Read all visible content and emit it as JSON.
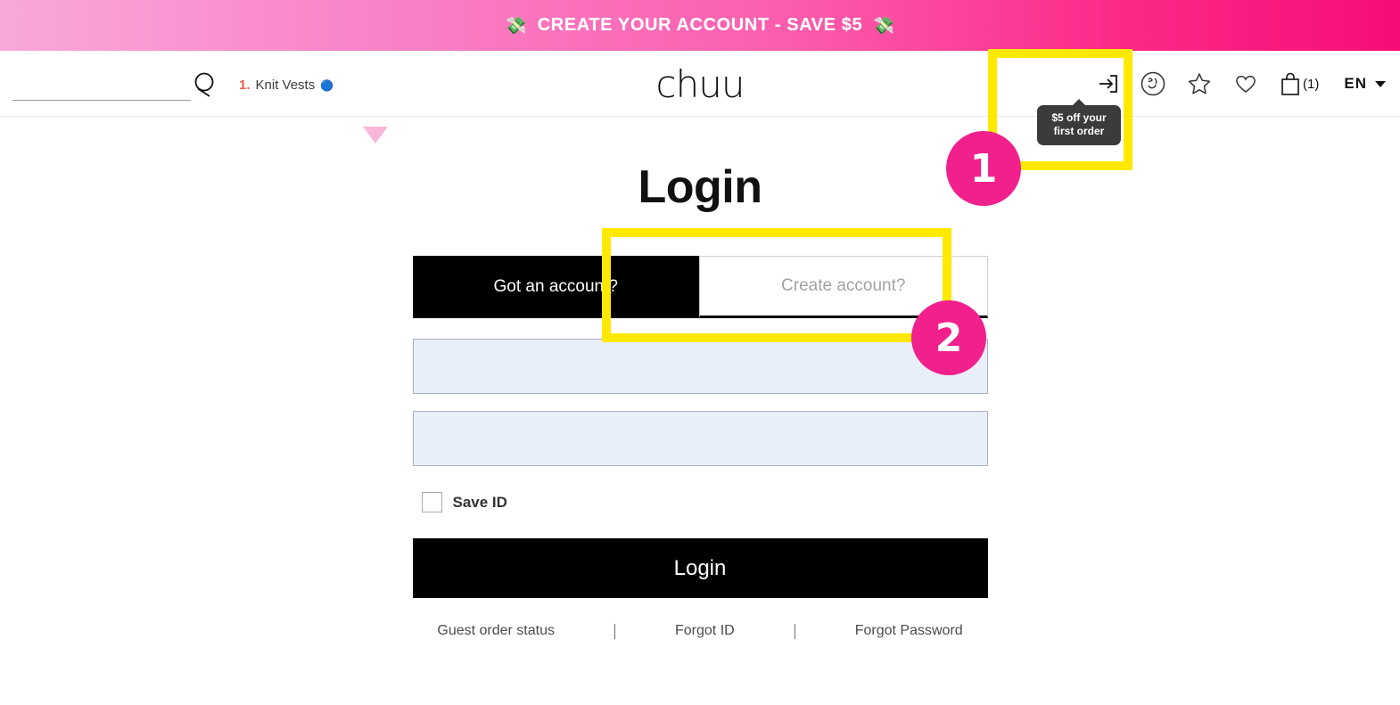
{
  "promo": {
    "text": "CREATE YOUR ACCOUNT - SAVE $5",
    "emoji_left": "💸",
    "emoji_right": "💸",
    "gradient_from": "#f9a9d8",
    "gradient_to": "#f70d74"
  },
  "header": {
    "search": {
      "value": "",
      "placeholder": ""
    },
    "search_icon": "search-icon",
    "hot_keyword": {
      "rank": "1.",
      "word": "Knit Vests",
      "emoji": "🔵"
    },
    "keyword_toggle_icon": "triangle-down-icon",
    "logo": "chuu",
    "icons": {
      "login": "login-arrow-icon",
      "face": "face-icon",
      "star": "star-icon",
      "heart": "heart-icon",
      "cart": "shopping-bag-icon"
    },
    "cart_count": "(1)",
    "language": {
      "value": "EN",
      "caret": "chevron-down-icon"
    }
  },
  "tooltip": {
    "line1": "$5 off your",
    "line2": "first order"
  },
  "main": {
    "title": "Login",
    "tabs": [
      {
        "label": "Got an account?",
        "active": true
      },
      {
        "label": "Create account?",
        "active": false
      }
    ],
    "fields": [
      {
        "name": "id",
        "value": "",
        "placeholder": ""
      },
      {
        "name": "password",
        "value": "",
        "placeholder": ""
      }
    ],
    "save_id_label": "Save ID",
    "save_id_checked": false,
    "login_button": "Login",
    "helper_links": [
      "Guest order status",
      "Forgot ID",
      "Forgot Password"
    ]
  },
  "annotations": {
    "badge1": "1",
    "badge2": "2",
    "highlight_color": "#ffe900",
    "badge_color": "#f2208c"
  }
}
